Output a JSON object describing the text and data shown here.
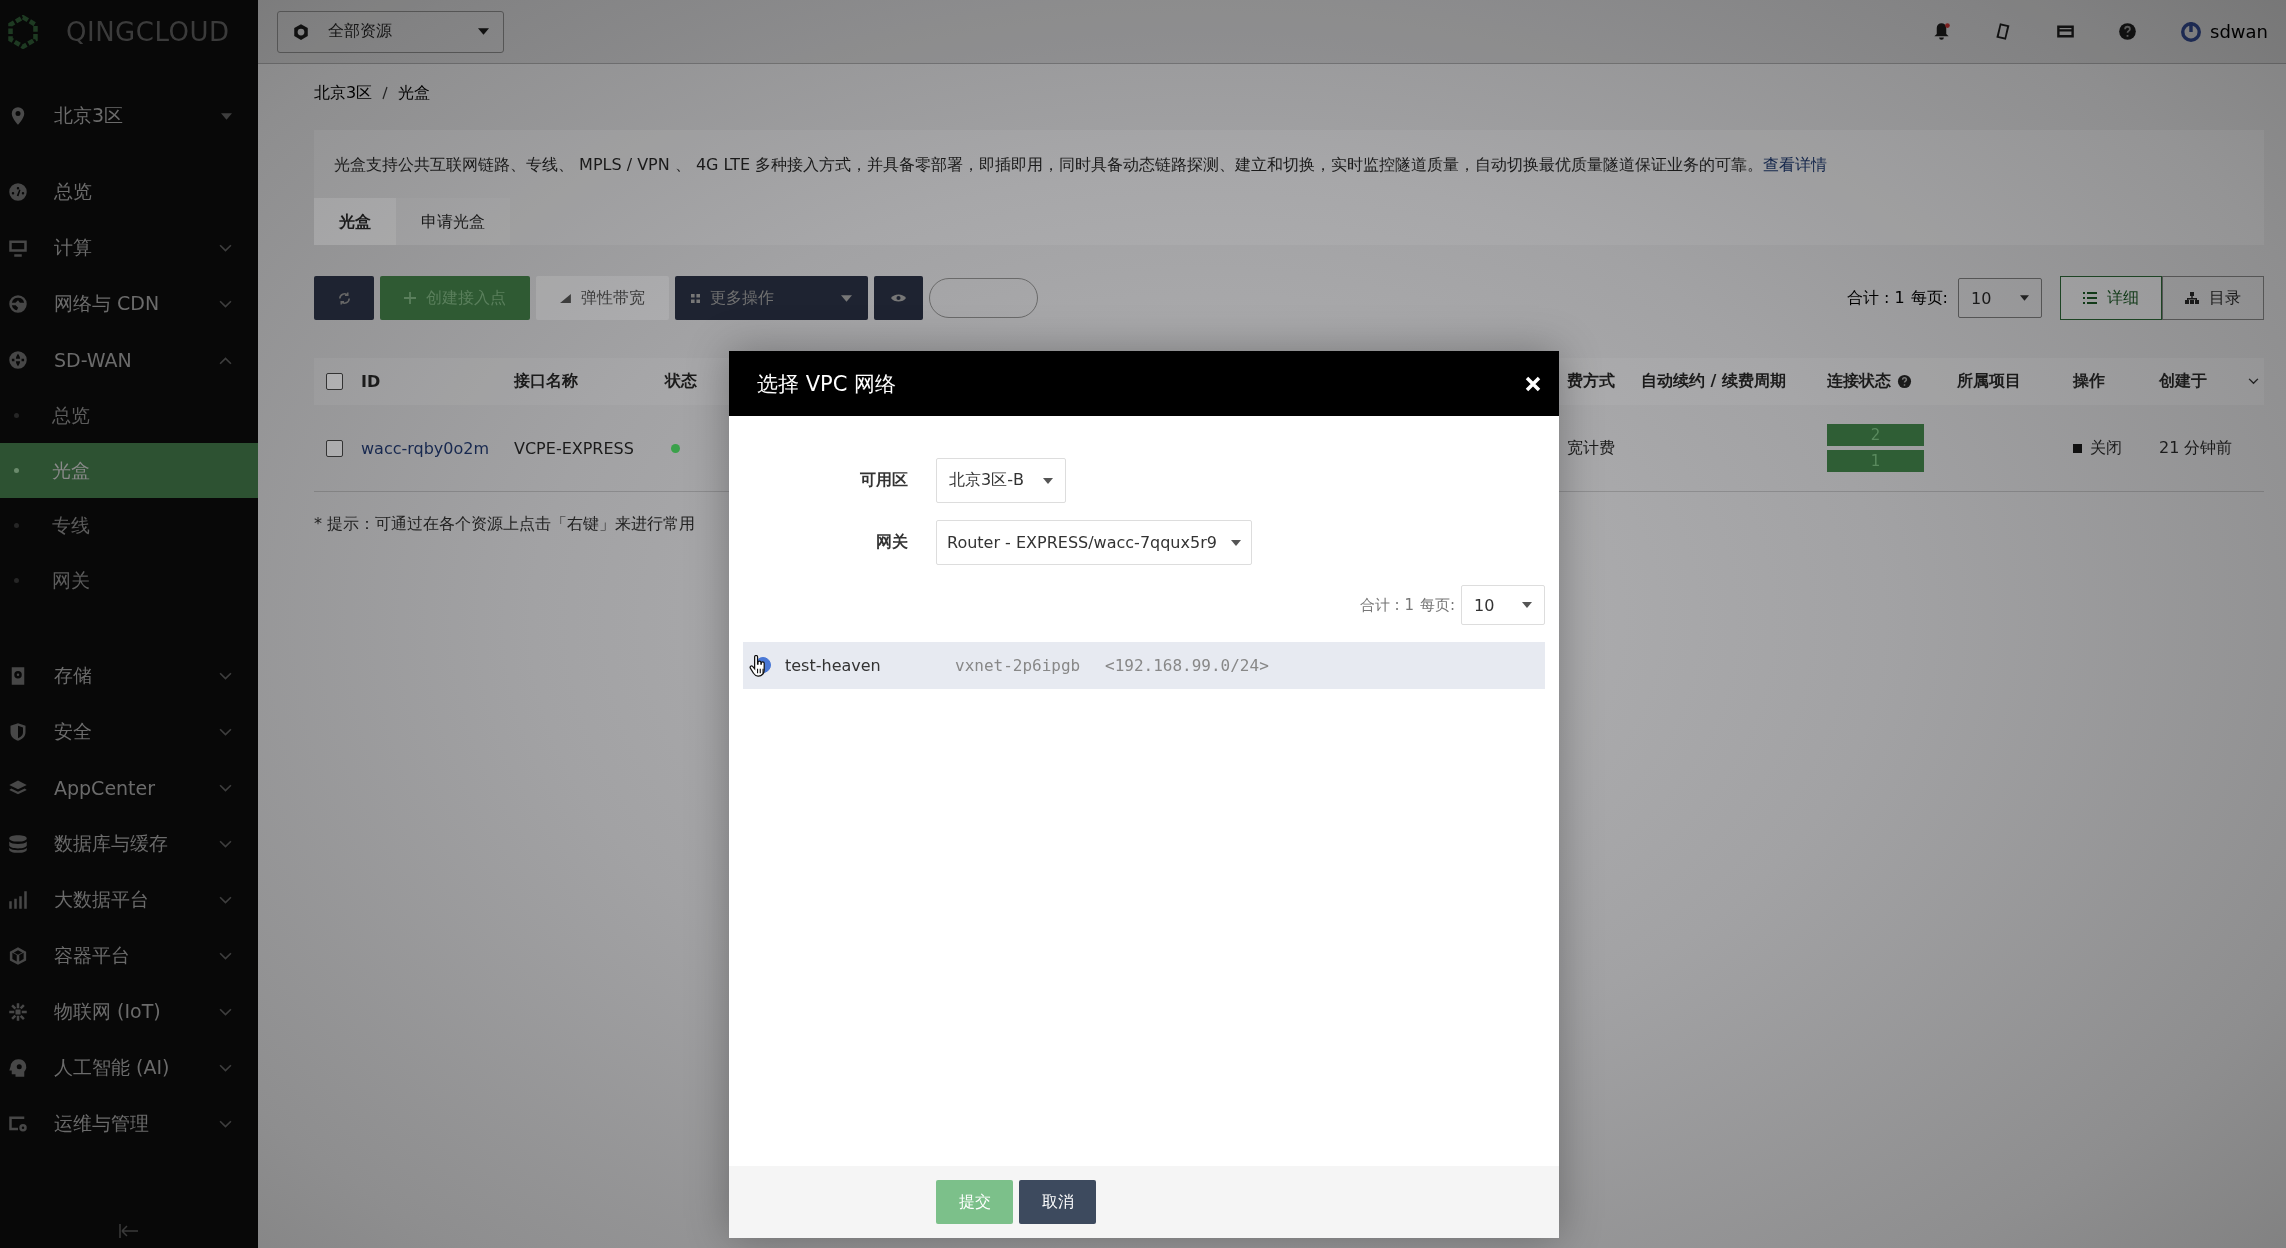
{
  "sidebar": {
    "logo": "QINGCLOUD",
    "region": "北京3区",
    "items": [
      {
        "kind": "link",
        "label": "总览"
      },
      {
        "kind": "group",
        "label": "计算",
        "expanded": false
      },
      {
        "kind": "group",
        "label": "网络与 CDN",
        "expanded": false
      },
      {
        "kind": "group",
        "label": "SD-WAN",
        "expanded": true,
        "children": [
          {
            "label": "总览",
            "selected": false
          },
          {
            "label": "光盒",
            "selected": true
          },
          {
            "label": "专线",
            "selected": false
          },
          {
            "label": "网关",
            "selected": false
          }
        ]
      },
      {
        "kind": "group",
        "label": "存储",
        "expanded": false
      },
      {
        "kind": "group",
        "label": "安全",
        "expanded": false
      },
      {
        "kind": "group",
        "label": "AppCenter",
        "expanded": false
      },
      {
        "kind": "group",
        "label": "数据库与缓存",
        "expanded": false
      },
      {
        "kind": "group",
        "label": "大数据平台",
        "expanded": false
      },
      {
        "kind": "group",
        "label": "容器平台",
        "expanded": false
      },
      {
        "kind": "group",
        "label": "物联网 (IoT)",
        "expanded": false
      },
      {
        "kind": "group",
        "label": "人工智能 (AI)",
        "expanded": false
      },
      {
        "kind": "group",
        "label": "运维与管理",
        "expanded": false
      }
    ]
  },
  "topbar": {
    "resource_selector": "全部资源",
    "user": "sdwan"
  },
  "breadcrumb": [
    "北京3区",
    "光盒"
  ],
  "description": {
    "text": "光盒支持公共互联网链路、专线、 MPLS / VPN 、 4G LTE 多种接入方式，并具备零部署，即插即用，同时具备动态链路探测、建立和切换，实时监控隧道质量，自动切换最优质量隧道保证业务的可靠。",
    "link": "查看详情"
  },
  "tabs": [
    {
      "label": "光盒",
      "selected": true
    },
    {
      "label": "申请光盒",
      "selected": false
    }
  ],
  "toolbar": {
    "create": "创建接入点",
    "bandwidth": {
      "label": "弹性带宽",
      "disabled": true
    },
    "more": "更多操作",
    "total": "合计 : 1",
    "per_page_label": "每页:",
    "per_page": "10",
    "views": [
      {
        "label": "详细",
        "selected": true
      },
      {
        "label": "目录",
        "selected": false
      }
    ]
  },
  "table": {
    "columns": [
      "ID",
      "接口名称",
      "状态",
      "费方式",
      "自动续约 / 续费周期",
      "连接状态",
      "所属项目",
      "操作",
      "创建于"
    ],
    "select_all": {
      "checked": false
    },
    "rows": [
      {
        "checked": false,
        "id": "wacc-rqby0o2m",
        "name": "VCPE-EXPRESS",
        "color": "#3aa14a",
        "billing": "宽计费",
        "connections": [
          "2",
          "1"
        ],
        "action": "关闭",
        "created": "21 分钟前"
      }
    ]
  },
  "hint": "* 提示：可通过在各个资源上点击「右键」来进行常用",
  "modal": {
    "title": "选择 VPC 网络",
    "zone_label": "可用区",
    "zone": "北京3区-B",
    "gateway_label": "网关",
    "gateway": "Router - EXPRESS/wacc-7qqux5r9",
    "total": "合计 : 1",
    "per_page_label": "每页:",
    "per_page": "10",
    "networks": [
      {
        "name": "test-heaven",
        "id": "vxnet-2p6ipgb",
        "cidr": "<192.168.99.0/24>",
        "selected": true
      }
    ],
    "submit": "提交",
    "cancel": "取消"
  }
}
